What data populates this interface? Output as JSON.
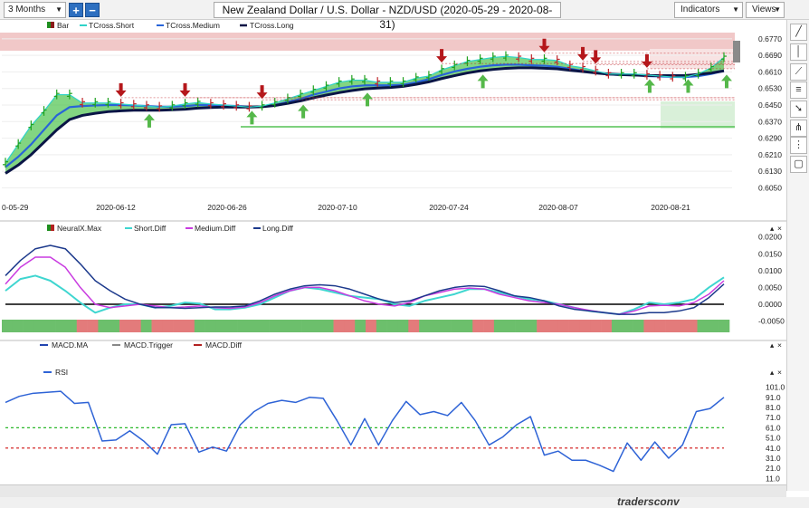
{
  "toolbar": {
    "period_label": "3 Months",
    "add_label": "+",
    "remove_label": "−",
    "title": "New Zealand Dollar / U.S. Dollar - NZD/USD (2020-05-29 - 2020-08-31)",
    "indicators_label": "Indicators",
    "views_label": "Views"
  },
  "brand_text": "tradersconv",
  "chart_data": [
    {
      "type": "line",
      "panel": "price",
      "legend": [
        "Bar",
        "TCross.Short",
        "TCross.Medium",
        "TCross.Long"
      ],
      "x_labels": [
        "0-05-29",
        "2020-06-12",
        "2020-06-26",
        "2020-07-10",
        "2020-07-24",
        "2020-08-07",
        "2020-08-21"
      ],
      "y_ticks": [
        "0.6770",
        "0.6690",
        "0.6610",
        "0.6530",
        "0.6450",
        "0.6370",
        "0.6290",
        "0.6210",
        "0.6130",
        "0.6050"
      ],
      "ylim": [
        0.603,
        0.68
      ],
      "colors": {
        "bar": "#1fa21f",
        "short": "#2fd3c8",
        "medium": "#2864d8",
        "long": "#0a1546",
        "fill": "#3fbe3f",
        "down_arrow": "#b5171b",
        "up_arrow": "#55b84a"
      },
      "series": [
        {
          "name": "TCross.Short",
          "values": [
            0.617,
            0.626,
            0.635,
            0.642,
            0.65,
            0.65,
            0.646,
            0.646,
            0.646,
            0.6455,
            0.645,
            0.6445,
            0.644,
            0.6445,
            0.6455,
            0.6462,
            0.6455,
            0.645,
            0.6445,
            0.644,
            0.6445,
            0.646,
            0.648,
            0.65,
            0.652,
            0.654,
            0.656,
            0.657,
            0.657,
            0.656,
            0.656,
            0.656,
            0.658,
            0.659,
            0.662,
            0.664,
            0.666,
            0.667,
            0.668,
            0.6685,
            0.668,
            0.667,
            0.667,
            0.6665,
            0.664,
            0.663,
            0.6615,
            0.66,
            0.66,
            0.66,
            0.6595,
            0.659,
            0.6585,
            0.6585,
            0.66,
            0.663,
            0.668
          ]
        },
        {
          "name": "TCross.Medium",
          "values": [
            0.615,
            0.62,
            0.626,
            0.633,
            0.64,
            0.644,
            0.6445,
            0.6448,
            0.645,
            0.645,
            0.6448,
            0.6445,
            0.6442,
            0.6442,
            0.6445,
            0.645,
            0.645,
            0.6448,
            0.6445,
            0.6442,
            0.6442,
            0.645,
            0.6465,
            0.648,
            0.65,
            0.6515,
            0.653,
            0.654,
            0.6545,
            0.6545,
            0.6545,
            0.6548,
            0.656,
            0.6575,
            0.6595,
            0.6612,
            0.6625,
            0.6635,
            0.6642,
            0.6645,
            0.6645,
            0.6642,
            0.664,
            0.6635,
            0.6625,
            0.6615,
            0.6605,
            0.6598,
            0.6595,
            0.6594,
            0.659,
            0.6588,
            0.6586,
            0.6585,
            0.659,
            0.66,
            0.6615
          ]
        },
        {
          "name": "TCross.Long",
          "values": [
            0.612,
            0.616,
            0.621,
            0.627,
            0.633,
            0.638,
            0.64,
            0.641,
            0.6418,
            0.6422,
            0.6425,
            0.6425,
            0.6425,
            0.6427,
            0.643,
            0.6435,
            0.6438,
            0.644,
            0.644,
            0.644,
            0.6442,
            0.6448,
            0.6458,
            0.647,
            0.6485,
            0.6498,
            0.651,
            0.652,
            0.6528,
            0.6532,
            0.6535,
            0.654,
            0.655,
            0.6562,
            0.6578,
            0.6592,
            0.6605,
            0.6615,
            0.6622,
            0.6627,
            0.663,
            0.663,
            0.6628,
            0.6625,
            0.6618,
            0.6612,
            0.6605,
            0.66,
            0.6597,
            0.6595,
            0.6593,
            0.6592,
            0.6592,
            0.6593,
            0.6598,
            0.6605,
            0.6615
          ]
        }
      ]
    },
    {
      "type": "line",
      "panel": "neuralx",
      "legend": [
        "NeuralX.Max",
        "Short.Diff",
        "Medium.Diff",
        "Long.Diff"
      ],
      "y_ticks": [
        "0.0200",
        "0.0150",
        "0.0100",
        "0.0050",
        "0.0000",
        "-0.0050"
      ],
      "ylim": [
        -0.007,
        0.021
      ],
      "colors": {
        "short": "#3fd6d0",
        "medium": "#c93be0",
        "long": "#1d3a8c",
        "zero": "#000000",
        "bull": "#6cbf6c",
        "bear": "#e37b7b"
      },
      "series": [
        {
          "name": "Short.Diff",
          "values": [
            0.004,
            0.0075,
            0.0085,
            0.007,
            0.004,
            0.0005,
            -0.0025,
            -0.001,
            0.0,
            0.0,
            -0.001,
            -0.0005,
            0.0005,
            0.0002,
            -0.0015,
            -0.0015,
            -0.001,
            0.0,
            0.002,
            0.004,
            0.005,
            0.0045,
            0.0035,
            0.0025,
            0.002,
            0.0015,
            0.0,
            -0.0005,
            0.001,
            0.002,
            0.003,
            0.0045,
            0.0045,
            0.0035,
            0.0025,
            0.0015,
            0.001,
            0.0,
            -0.001,
            -0.002,
            -0.0025,
            -0.003,
            -0.0015,
            0.0005,
            0.0,
            0.0005,
            0.0015,
            0.005,
            0.008
          ]
        },
        {
          "name": "Medium.Diff",
          "values": [
            0.006,
            0.011,
            0.014,
            0.014,
            0.011,
            0.005,
            0.0,
            -0.001,
            -0.0005,
            0.0,
            -0.0005,
            -0.001,
            -0.0008,
            -0.0005,
            -0.001,
            -0.0012,
            -0.0008,
            0.0005,
            0.0025,
            0.004,
            0.005,
            0.005,
            0.004,
            0.0025,
            0.001,
            0.0,
            -0.0005,
            0.0005,
            0.0025,
            0.0035,
            0.0045,
            0.0048,
            0.0045,
            0.003,
            0.002,
            0.001,
            0.0005,
            0.0,
            -0.001,
            -0.0018,
            -0.0025,
            -0.003,
            -0.002,
            -0.0005,
            -0.0003,
            -0.0005,
            0.0005,
            0.003,
            0.007
          ]
        },
        {
          "name": "Long.Diff",
          "values": [
            0.0085,
            0.013,
            0.0165,
            0.0175,
            0.0165,
            0.012,
            0.007,
            0.004,
            0.0015,
            0.0,
            -0.001,
            -0.001,
            -0.0012,
            -0.001,
            -0.0008,
            -0.0008,
            -0.0005,
            0.001,
            0.003,
            0.0045,
            0.0055,
            0.0058,
            0.0055,
            0.0045,
            0.003,
            0.0015,
            0.0005,
            0.001,
            0.0025,
            0.004,
            0.005,
            0.0055,
            0.0053,
            0.004,
            0.0025,
            0.002,
            0.001,
            -0.0005,
            -0.0015,
            -0.002,
            -0.0025,
            -0.003,
            -0.003,
            -0.0025,
            -0.0025,
            -0.002,
            -0.001,
            0.002,
            0.006
          ]
        }
      ],
      "regime_bar": [
        "bull",
        "bull",
        "bull",
        "bull",
        "bull",
        "bull",
        "bull",
        "bear",
        "bear",
        "bull",
        "bull",
        "bear",
        "bear",
        "bull",
        "bear",
        "bear",
        "bear",
        "bear",
        "bull",
        "bull",
        "bull",
        "bull",
        "bull",
        "bull",
        "bull",
        "bull",
        "bull",
        "bull",
        "bull",
        "bull",
        "bull",
        "bear",
        "bear",
        "bull",
        "bear",
        "bull",
        "bull",
        "bull",
        "bear",
        "bull",
        "bull",
        "bull",
        "bull",
        "bull",
        "bear",
        "bear",
        "bull",
        "bull",
        "bull",
        "bull",
        "bear",
        "bear",
        "bear",
        "bear",
        "bear",
        "bear",
        "bear",
        "bull",
        "bull",
        "bull",
        "bear",
        "bear",
        "bear",
        "bear",
        "bear",
        "bull",
        "bull",
        "bull"
      ]
    },
    {
      "type": "line",
      "panel": "macd_rsi",
      "legend": [
        "MACD.MA",
        "MACD.Trigger",
        "MACD.Diff",
        "RSI"
      ],
      "y_ticks": [
        "101.0",
        "91.0",
        "81.0",
        "71.0",
        "61.0",
        "51.0",
        "41.0",
        "31.0",
        "21.0",
        "11.0"
      ],
      "ylim": [
        6.0,
        106.0
      ],
      "overbought": 61.0,
      "oversold": 41.0,
      "colors": {
        "rsi": "#2e63d6",
        "overbought": "#2cb82c",
        "oversold": "#d11414"
      },
      "series": [
        {
          "name": "RSI",
          "values": [
            86,
            92,
            95,
            96,
            97,
            85,
            86,
            48,
            49,
            58,
            48,
            35,
            64,
            65,
            37,
            42,
            38,
            64,
            77,
            85,
            88,
            86,
            91,
            90,
            68,
            44,
            70,
            44,
            68,
            87,
            74,
            77,
            73,
            86,
            68,
            44,
            52,
            64,
            72,
            34,
            38,
            29,
            29,
            24,
            18,
            46,
            29,
            47,
            31,
            44,
            77,
            80,
            91
          ]
        }
      ]
    }
  ]
}
